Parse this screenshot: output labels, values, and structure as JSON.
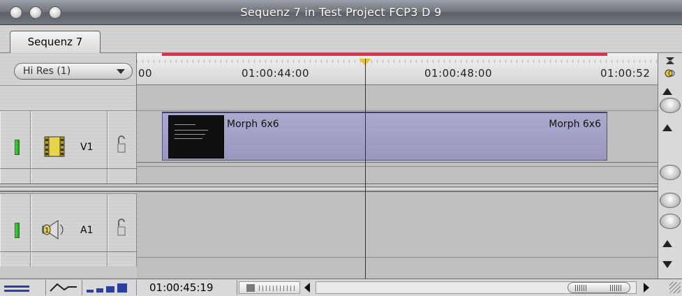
{
  "window": {
    "title": "Sequenz 7 in Test Project FCP3 D 9"
  },
  "tabs": [
    {
      "label": "Sequenz 7",
      "active": true
    }
  ],
  "resolution_popup": {
    "value": "Hi Res  (1)"
  },
  "ruler": {
    "labels": [
      "00",
      "01:00:44:00",
      "01:00:48:00",
      "01:00:52"
    ],
    "render_bar_color": "#e0304a",
    "playhead_color": "#e7c431"
  },
  "tracks": [
    {
      "name": "V1",
      "type": "video",
      "icon": "film-strip-icon",
      "clip": {
        "name_start": "Morph 6x6",
        "name_end": "Morph 6x6",
        "color": "#9a9ac0"
      }
    },
    {
      "name": "A1",
      "type": "audio",
      "icon": "speaker-icon",
      "clip": null
    }
  ],
  "bottom_bar": {
    "timecode": "01:00:45:19",
    "buttons": [
      "track-height-icon",
      "clip-overlay-icon",
      "track-size-icon"
    ]
  }
}
